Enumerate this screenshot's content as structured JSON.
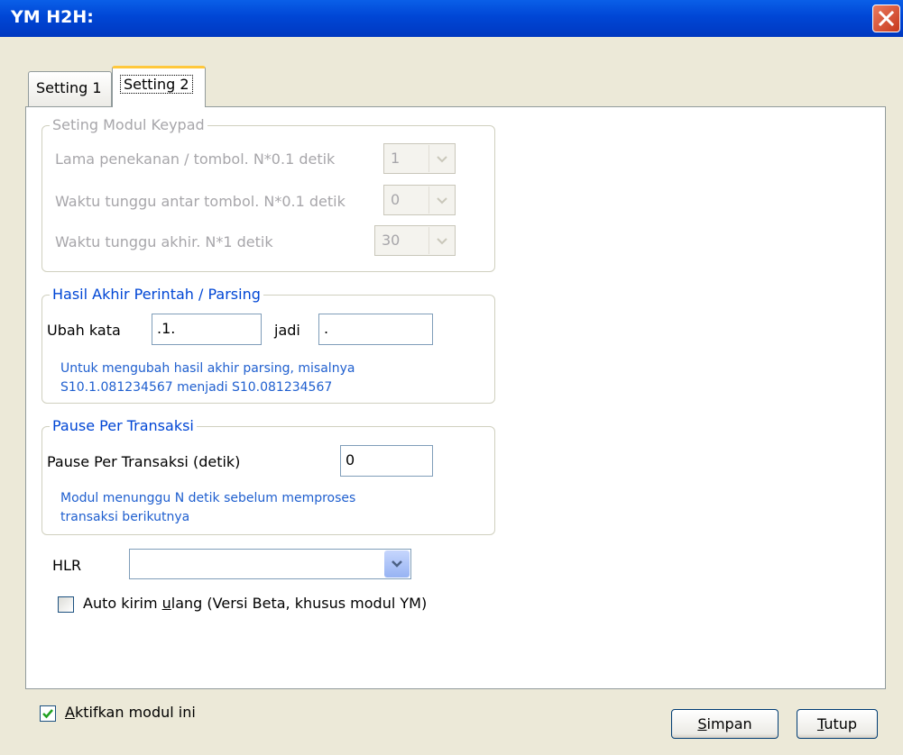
{
  "window": {
    "title": "YM H2H:"
  },
  "tabs": [
    {
      "label": "Setting 1",
      "active": false
    },
    {
      "label": "Setting 2",
      "active": true
    }
  ],
  "keypad_group": {
    "legend": "Seting Modul Keypad",
    "rows": [
      {
        "label": "Lama penekanan / tombol. N*0.1 detik",
        "value": "1"
      },
      {
        "label": "Waktu tunggu antar tombol. N*0.1 detik",
        "value": "0"
      },
      {
        "label": "Waktu tunggu akhir. N*1 detik",
        "value": "30"
      }
    ]
  },
  "parsing_group": {
    "legend": "Hasil Akhir Perintah / Parsing",
    "ubah_label": "Ubah kata",
    "ubah_value": ".1.",
    "jadi_label": "jadi",
    "jadi_value": ".",
    "note_line1": "Untuk mengubah hasil akhir parsing, misalnya",
    "note_line2": "S10.1.081234567 menjadi S10.081234567"
  },
  "pause_group": {
    "legend": "Pause Per Transaksi",
    "label": "Pause Per Transaksi (detik)",
    "value": "0",
    "note_line1": "Modul menunggu N detik sebelum memproses",
    "note_line2": "transaksi berikutnya"
  },
  "hlr": {
    "label": "HLR",
    "value": ""
  },
  "auto_kirim": {
    "label_before": "Auto kirim ",
    "label_underlined": "u",
    "label_after": "lang (Versi Beta, khusus modul YM)",
    "checked": false
  },
  "aktifkan": {
    "label_underlined": "A",
    "label_after": "ktifkan modul ini",
    "checked": true
  },
  "buttons": {
    "simpan_u": "S",
    "simpan_rest": "impan",
    "tutup_u": "T",
    "tutup_rest": "utup"
  },
  "colors": {
    "titlebar": "#0046D5",
    "group_legend_blue": "#0046D5",
    "note_blue": "#1F5FCF",
    "disabled_text": "#A7A6AA",
    "tab_highlight": "#FFC83C"
  }
}
